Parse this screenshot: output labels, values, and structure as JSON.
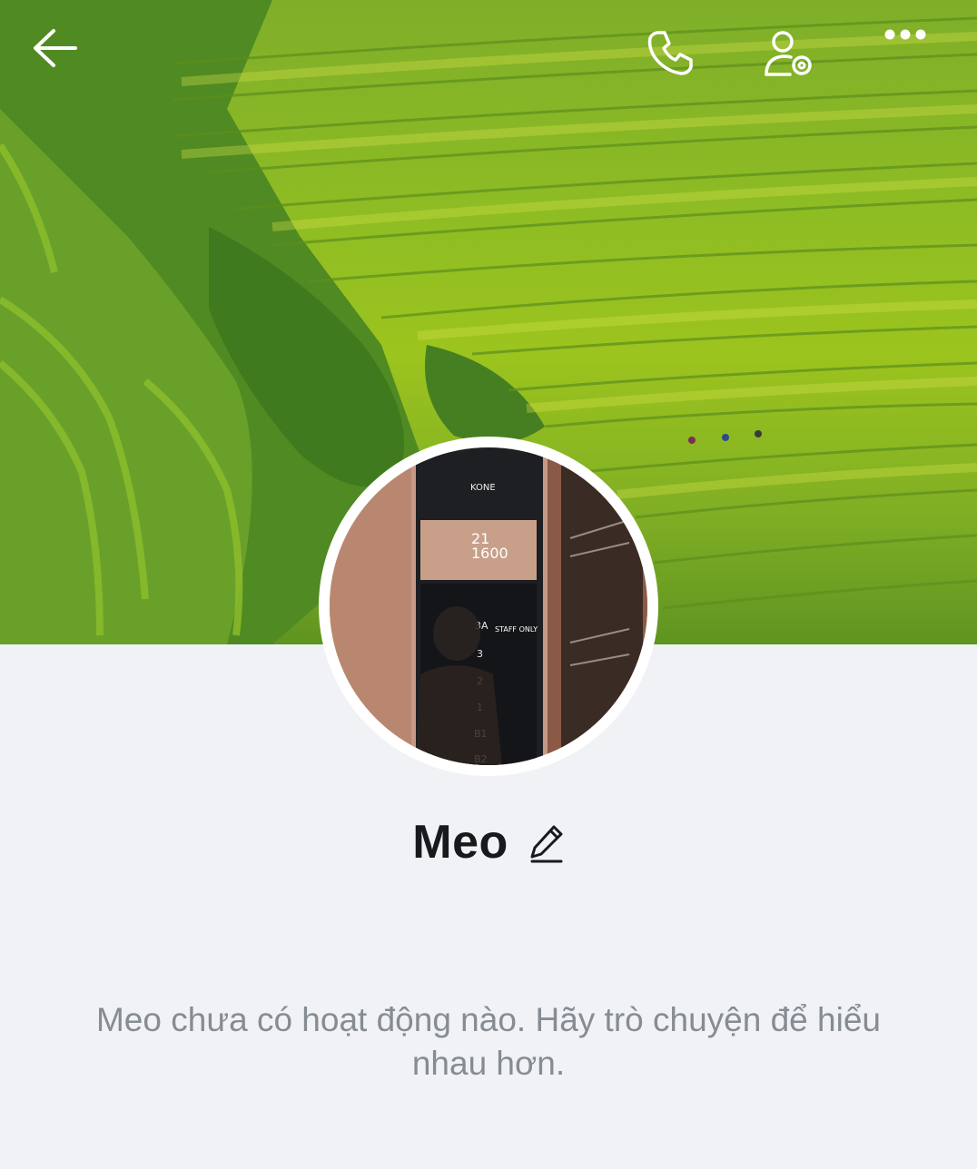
{
  "header": {
    "back_icon": "arrow-left-icon",
    "call_icon": "phone-icon",
    "settings_icon": "user-settings-icon",
    "more_icon": "more-horizontal-icon"
  },
  "cover": {
    "description_icon": "cover-photo"
  },
  "avatar": {
    "labels": {
      "brand": "KONE",
      "floor": "21",
      "load": "1600",
      "staff": "STAFF ONLY",
      "floors": [
        "3A",
        "3",
        "2",
        "1",
        "B1",
        "B2"
      ]
    }
  },
  "profile": {
    "name": "Meo",
    "edit_icon": "pencil-icon"
  },
  "feed": {
    "empty_message": "Meo chưa có hoạt động nào. Hãy trò chuyện để hiểu nhau hơn."
  },
  "colors": {
    "background": "#f1f2f5",
    "name_text": "#17191c",
    "muted_text": "#858c93"
  }
}
